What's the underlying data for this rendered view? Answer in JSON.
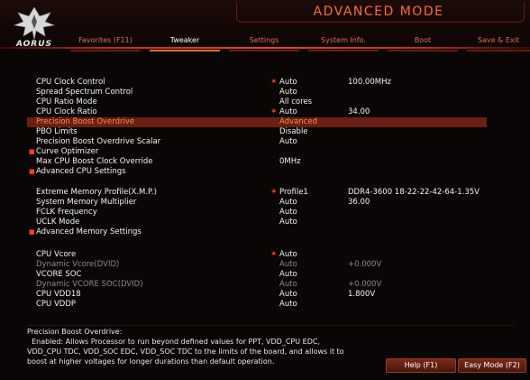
{
  "header": {
    "logo_text": "AORUS",
    "mode_title": "ADVANCED MODE",
    "tabs": [
      {
        "label": "Favorites (F11)"
      },
      {
        "label": "Tweaker"
      },
      {
        "label": "Settings"
      },
      {
        "label": "System Info."
      },
      {
        "label": "Boot"
      },
      {
        "label": "Save & Exit"
      }
    ],
    "active_tab": "Tweaker"
  },
  "settings": [
    {
      "label": "CPU Clock Control",
      "value": "Auto",
      "extra": "100.00MHz",
      "star": true
    },
    {
      "label": "Spread Spectrum Control",
      "value": "Auto",
      "extra": ""
    },
    {
      "label": "CPU Ratio Mode",
      "value": "All cores",
      "extra": ""
    },
    {
      "label": "CPU Clock Ratio",
      "value": "Auto",
      "extra": "34.00",
      "star": true
    },
    {
      "label": "Precision Boost Overdrive",
      "value": "Advanced",
      "extra": "",
      "selected": true
    },
    {
      "label": "PBO Limits",
      "value": "Disable",
      "extra": ""
    },
    {
      "label": "Precision Boost Overdrive Scalar",
      "value": "Auto",
      "extra": ""
    },
    {
      "label": "Curve Optimizer",
      "value": "",
      "extra": "",
      "submenu": true
    },
    {
      "label": "Max CPU Boost Clock Override",
      "value": "0MHz",
      "extra": ""
    },
    {
      "label": "Advanced CPU Settings",
      "value": "",
      "extra": "",
      "submenu": true
    },
    {
      "label": "Extreme Memory Profile(X.M.P.)",
      "value": "Profile1",
      "extra": "DDR4-3600 18-22-22-42-64-1.35V",
      "star": true
    },
    {
      "label": "System Memory Multiplier",
      "value": "Auto",
      "extra": "36.00"
    },
    {
      "label": "FCLK Frequency",
      "value": "Auto",
      "extra": ""
    },
    {
      "label": "UCLK Mode",
      "value": "Auto",
      "extra": ""
    },
    {
      "label": "Advanced Memory Settings",
      "value": "",
      "extra": "",
      "submenu": true
    },
    {
      "label": "CPU Vcore",
      "value": "Auto",
      "extra": "",
      "star": true
    },
    {
      "label": "Dynamic Vcore(DVID)",
      "value": "Auto",
      "extra": "+0.000V",
      "dim": true
    },
    {
      "label": "VCORE SOC",
      "value": "Auto",
      "extra": ""
    },
    {
      "label": "Dynamic VCORE SOC(DVID)",
      "value": "Auto",
      "extra": "+0.000V",
      "dim": true
    },
    {
      "label": "CPU VDD18",
      "value": "Auto",
      "extra": "1.800V"
    },
    {
      "label": "CPU VDDP",
      "value": "Auto",
      "extra": ""
    }
  ],
  "help": {
    "title": "Precision Boost Overdrive:",
    "lines": [
      "  Enabled: Allows Processor to run beyond defined values for PPT, VDD_CPU EDC,",
      "VDD_CPU TDC, VDD_SOC EDC, VDD_SOC TDC to the limits of the board, and allows it to",
      "boost at higher voltages for longer durations than default operation."
    ]
  },
  "buttons": {
    "help": "Help (F1)",
    "easy_mode": "Easy Mode (F2)"
  },
  "colors": {
    "accent": "#ff6a20",
    "selected_row": "#6a1f12",
    "star": "#ff4020",
    "dim_text": "#8a8a8a"
  }
}
